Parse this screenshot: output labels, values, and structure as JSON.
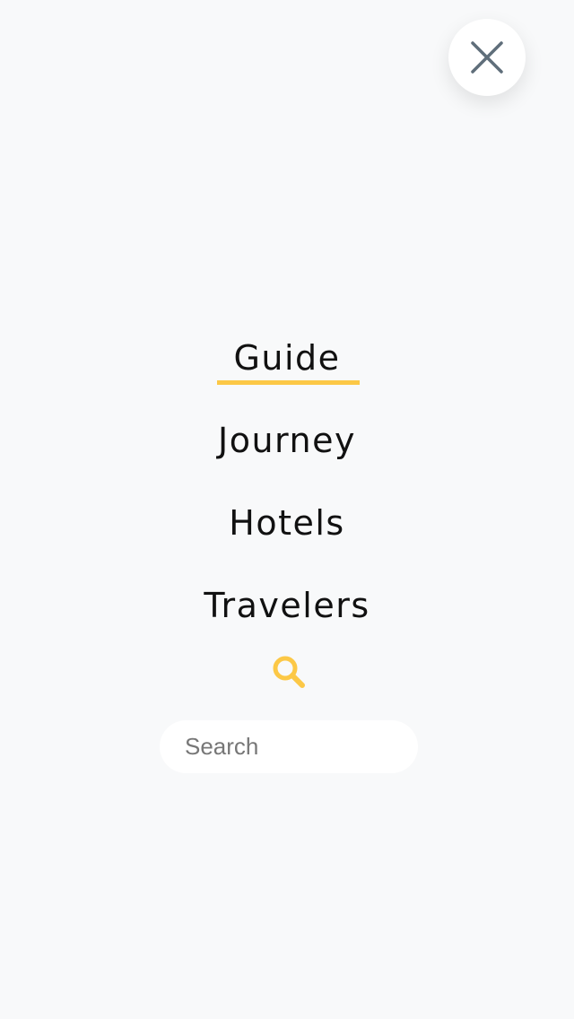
{
  "close": {
    "icon": "close-icon",
    "color": "#5f6e7a"
  },
  "nav": {
    "items": [
      {
        "label": "Guide",
        "active": true
      },
      {
        "label": "Journey",
        "active": false
      },
      {
        "label": "Hotels",
        "active": false
      },
      {
        "label": "Travelers",
        "active": false
      }
    ],
    "accent_color": "#fcc846"
  },
  "search": {
    "icon": "search-icon",
    "placeholder": "Search",
    "value": ""
  }
}
